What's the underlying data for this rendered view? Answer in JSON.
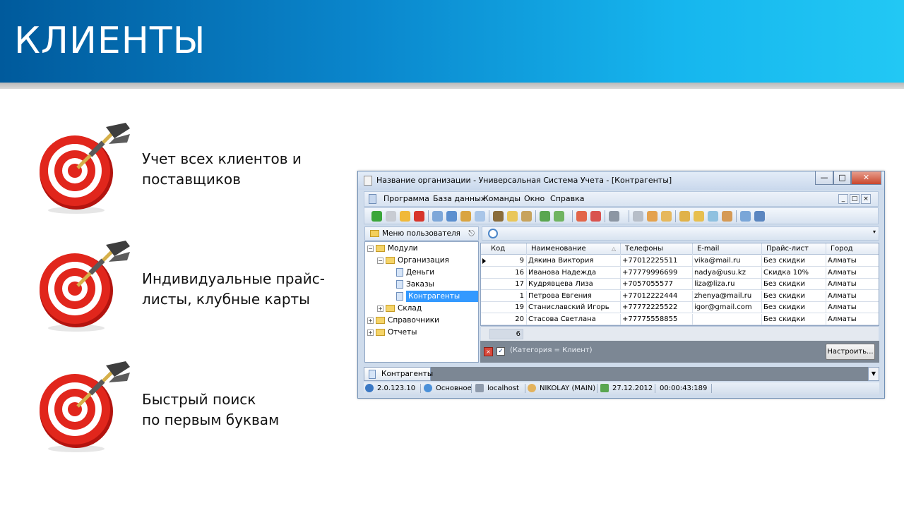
{
  "slide": {
    "title": "КЛИЕНТЫ",
    "bullets": [
      {
        "icon": "target-dart-icon",
        "text": "Учет всех клиентов и\nпоставщиков"
      },
      {
        "icon": "target-dart-icon",
        "text": "Индивидуальные прайс-\nлисты, клубные карты"
      },
      {
        "icon": "target-dart-icon",
        "text": "Быстрый поиск\nпо первым буквам"
      }
    ]
  },
  "window": {
    "title": "Название организации - Универсальная Система Учета - [Контрагенты]",
    "menu": [
      "Программа",
      "База данных",
      "Команды",
      "Окно",
      "Справка"
    ],
    "left_pane": {
      "title": "Меню пользователя",
      "tree": [
        {
          "label": "Модули",
          "type": "folder",
          "expanded": true
        },
        {
          "label": "Организация",
          "type": "folder",
          "expanded": true
        },
        {
          "label": "Деньги",
          "type": "doc"
        },
        {
          "label": "Заказы",
          "type": "doc"
        },
        {
          "label": "Контрагенты",
          "type": "doc",
          "selected": true
        },
        {
          "label": "Склад",
          "type": "folder",
          "expanded": false
        },
        {
          "label": "Справочники",
          "type": "folder",
          "expanded": false
        },
        {
          "label": "Отчеты",
          "type": "folder",
          "expanded": false
        }
      ]
    },
    "grid": {
      "columns": [
        "Код",
        "Наименование",
        "Телефоны",
        "E-mail",
        "Прайс-лист",
        "Город"
      ],
      "rows": [
        [
          "9",
          "Дякина Виктория",
          "+77012225511",
          "vika@mail.ru",
          "Без скидки",
          "Алматы"
        ],
        [
          "16",
          "Иванова Надежда",
          "+77779996699",
          "nadya@usu.kz",
          "Скидка 10%",
          "Алматы"
        ],
        [
          "17",
          "Кудрявцева Лиза",
          "+7057055577",
          "liza@liza.ru",
          "Без скидки",
          "Алматы"
        ],
        [
          "1",
          "Петрова Евгения",
          "+77012222444",
          "zhenya@mail.ru",
          "Без скидки",
          "Алматы"
        ],
        [
          "19",
          "Станиславский Игорь",
          "+77772225522",
          "igor@gmail.com",
          "Без скидки",
          "Алматы"
        ],
        [
          "20",
          "Стасова Светлана",
          "+77775558855",
          "",
          "Без скидки",
          "Алматы"
        ]
      ],
      "count": "6"
    },
    "filter": {
      "text": "(Категория = Клиент)",
      "button": "Настроить..."
    },
    "tab": "Контрагенты",
    "status": {
      "version": "2.0.123.10",
      "db": "Основное",
      "host": "localhost",
      "user": "NIKOLAY (MAIN)",
      "date": "27.12.2012",
      "time": "00:00:43:189"
    }
  },
  "colors": {
    "header_start": "#005a9c",
    "header_end": "#22c8f4",
    "target_red": "#d8201c",
    "selection": "#3399ff"
  }
}
